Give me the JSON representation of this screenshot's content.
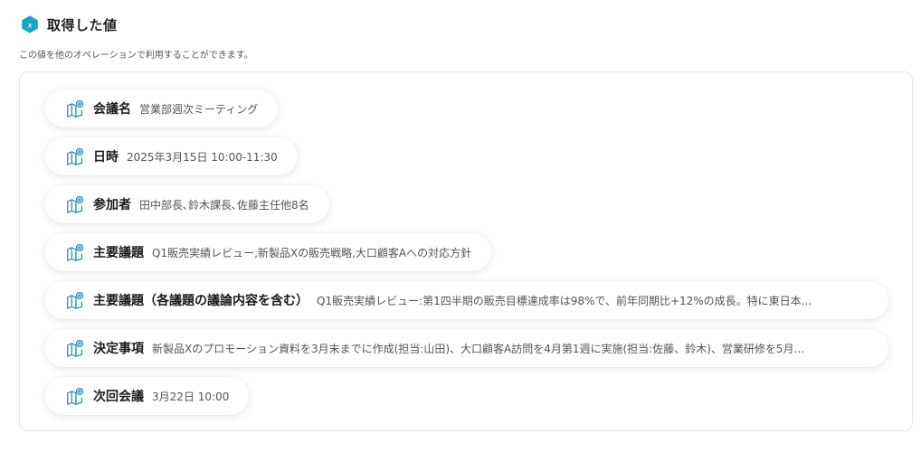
{
  "header": {
    "title": "取得した値",
    "subtitle": "この値を他のオペレーションで利用することができます。"
  },
  "items": [
    {
      "label": "会議名",
      "value": "営業部週次ミーティング"
    },
    {
      "label": "日時",
      "value": "2025年3月15日 10:00-11:30"
    },
    {
      "label": "参加者",
      "value": "田中部長､鈴木課長､佐藤主任他8名"
    },
    {
      "label": "主要議題",
      "value": "Q1販売実績レビュー,新製品Xの販売戦略,大口顧客Aへの対応方針"
    },
    {
      "label": "主要議題（各議題の議論内容を含む）",
      "value": "Q1販売実績レビュー:第1四半期の販売目標達成率は98%で、前年同期比+12%の成長。特に東日本..."
    },
    {
      "label": "決定事項",
      "value": "新製品Xのプロモーション資料を3月末までに作成(担当:山田)、大口顧客A訪問を4月第1週に実施(担当:佐藤、鈴木)、営業研修を5月..."
    },
    {
      "label": "次回会議",
      "value": "3月22日 10:00"
    }
  ],
  "colors": {
    "accent": "#16a6c9",
    "icon_stroke": "#2a8fb3"
  },
  "icons": {
    "header": "variable-hex-icon",
    "item": "book-pin-icon"
  }
}
